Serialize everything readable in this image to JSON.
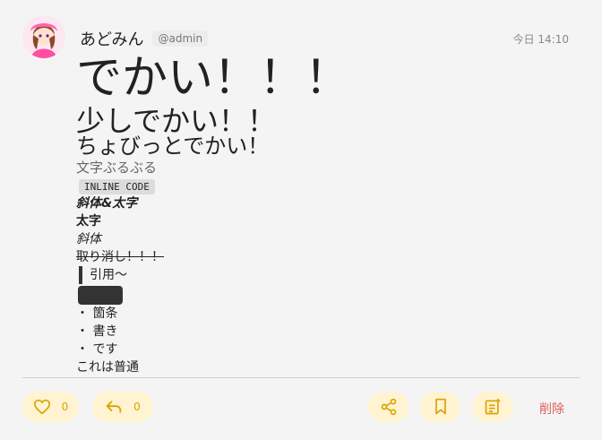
{
  "header": {
    "author_name": "あどみん",
    "handle": "@admin",
    "timestamp": "今日 14:10"
  },
  "post": {
    "h1": "でかい！！！",
    "h2": "少しでかい！！",
    "h3": "ちょびっとでかい！",
    "jelly": "文字ぶるぶる",
    "inline_code": "INLINE CODE",
    "bold_italic": "斜体&太字",
    "bold": "太字",
    "italic": "斜体",
    "strikethrough": "取り消し！！！",
    "quote": "引用〜",
    "list": [
      "・ 箇条",
      "・ 書き",
      "・ です"
    ],
    "plain": "これは普通"
  },
  "footer": {
    "like_count": "0",
    "reply_count": "0",
    "delete_label": "削除"
  },
  "colors": {
    "accent": "#d9a400",
    "pill_bg": "#fff3d1",
    "delete": "#e05b5b"
  },
  "icons": [
    "heart-icon",
    "reply-icon",
    "share-icon",
    "bookmark-icon",
    "note-icon"
  ]
}
